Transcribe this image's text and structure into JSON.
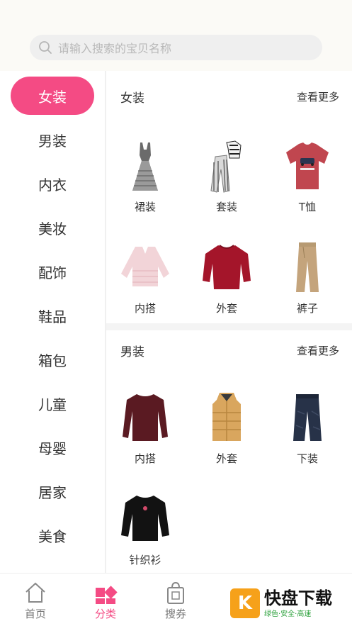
{
  "search": {
    "placeholder": "请输入搜索的宝贝名称"
  },
  "sidebar": {
    "items": [
      {
        "label": "女装",
        "active": true
      },
      {
        "label": "男装"
      },
      {
        "label": "内衣"
      },
      {
        "label": "美妆"
      },
      {
        "label": "配饰"
      },
      {
        "label": "鞋品"
      },
      {
        "label": "箱包"
      },
      {
        "label": "儿童"
      },
      {
        "label": "母婴"
      },
      {
        "label": "居家"
      },
      {
        "label": "美食"
      }
    ]
  },
  "sections": [
    {
      "title": "女装",
      "more": "查看更多",
      "items": [
        {
          "label": "裙装",
          "icon": "dress-icon"
        },
        {
          "label": "套装",
          "icon": "outfit-set-icon"
        },
        {
          "label": "T恤",
          "icon": "tshirt-icon"
        },
        {
          "label": "内搭",
          "icon": "knit-top-icon"
        },
        {
          "label": "外套",
          "icon": "sweater-icon"
        },
        {
          "label": "裤子",
          "icon": "pants-icon"
        }
      ]
    },
    {
      "title": "男装",
      "more": "查看更多",
      "items": [
        {
          "label": "内搭",
          "icon": "longsleeve-icon"
        },
        {
          "label": "外套",
          "icon": "puffer-vest-icon"
        },
        {
          "label": "下装",
          "icon": "trousers-icon"
        },
        {
          "label": "针织衫",
          "icon": "sweatshirt-icon"
        }
      ]
    }
  ],
  "tabbar": {
    "home": "首页",
    "category": "分类",
    "coupon": "搜券"
  },
  "watermark": {
    "brand": "快盘下载",
    "tagline": "绿色·安全·高速"
  },
  "colors": {
    "accent": "#f44b84",
    "background": "#fbfaf6"
  }
}
